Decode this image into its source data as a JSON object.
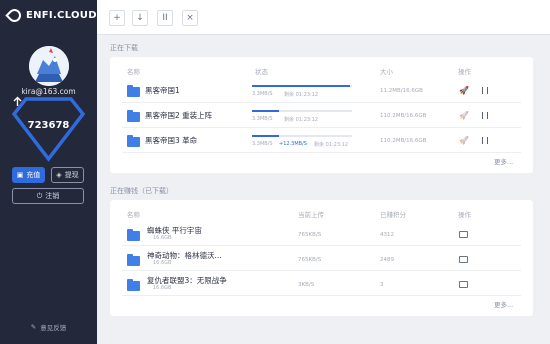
{
  "app": {
    "logo_text": "ENFI.CLOUD"
  },
  "sidebar": {
    "email": "kira@163.com",
    "balance": "723678",
    "recharge_label": "充值",
    "withdraw_label": "提现",
    "logout_label": "注销",
    "feedback_label": "意见反馈"
  },
  "toolbar": {
    "add": "+",
    "download": "↓",
    "pause": "II",
    "close": "×"
  },
  "downloading": {
    "title": "正在下载",
    "headers": {
      "name": "名称",
      "status": "状态",
      "size": "大小",
      "ops": "操作"
    },
    "rows": [
      {
        "name": "黑客帝国1",
        "sub": "",
        "speed_text": "3.3MB/S",
        "speed2": "",
        "remaining": "剩余 01:23:12",
        "size": "11.2MB/16.6GB",
        "progress": 0.98
      },
      {
        "name": "黑客帝国2 重装上阵",
        "sub": "",
        "speed_text": "3.3MB/S",
        "speed2": "",
        "remaining": "剩余 01:23:12",
        "size": "110.2MB/16.6GB",
        "progress": 0.27
      },
      {
        "name": "黑客帝国3 革命",
        "sub": "",
        "speed_text": "3.3MB/S",
        "speed2": "+12.3MB/S",
        "remaining": "剩余 01:23:12",
        "size": "110.2MB/16.6GB",
        "progress": 0.27
      }
    ],
    "more": "更多..."
  },
  "earning": {
    "title": "正在赚钱（已下载）",
    "headers": {
      "name": "名称",
      "upload": "当前上传",
      "points": "已赚积分",
      "ops": "操作"
    },
    "rows": [
      {
        "name": "蜘蛛侠 平行宇宙",
        "sub": "16.6GB",
        "upload": "765KB/S",
        "points": "4312"
      },
      {
        "name": "神奇动物：格林德沃...",
        "sub": "16.6GB",
        "upload": "765KB/S",
        "points": "2489"
      },
      {
        "name": "复仇者联盟3：无限战争",
        "sub": "16.6GB",
        "upload": "3KB/S",
        "points": "3"
      }
    ],
    "more": "更多..."
  }
}
